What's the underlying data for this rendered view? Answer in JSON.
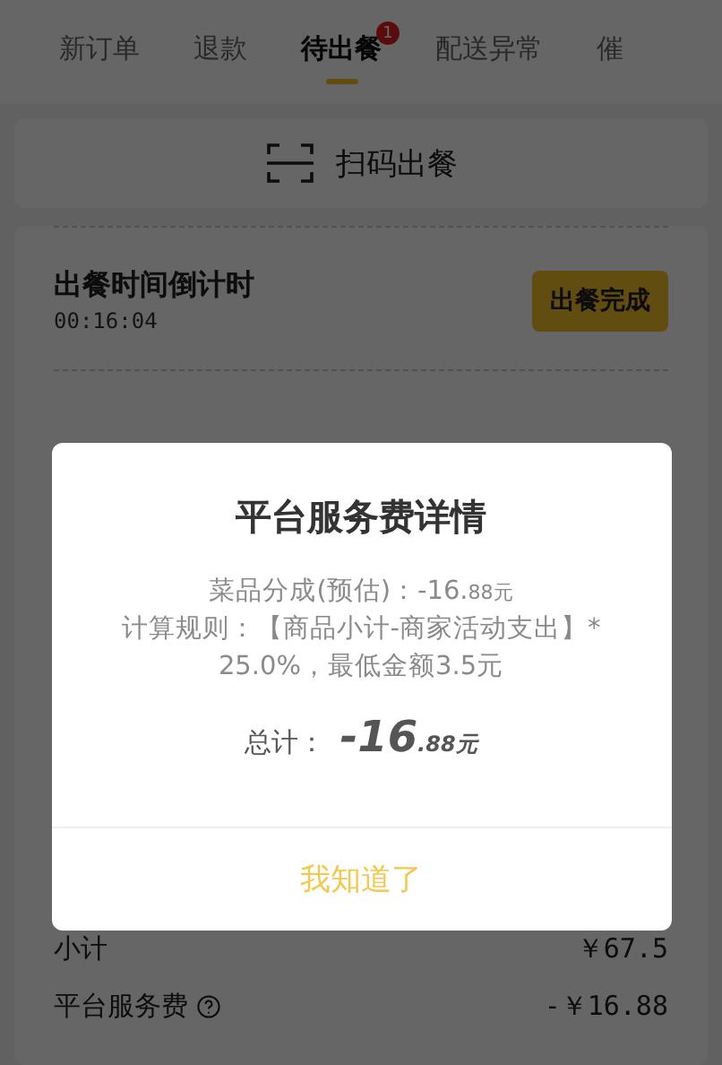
{
  "tabs": [
    {
      "label": "新订单",
      "selected": false
    },
    {
      "label": "退款",
      "selected": false
    },
    {
      "label": "待出餐",
      "selected": true,
      "badge": "1"
    },
    {
      "label": "配送异常",
      "selected": false
    },
    {
      "label": "催",
      "selected": false
    }
  ],
  "scan_button": {
    "label": "扫码出餐"
  },
  "order": {
    "countdown_title": "出餐时间倒计时",
    "countdown": "00:16:04",
    "done_button": "出餐完成",
    "fees": [
      {
        "label": "小计",
        "value": "￥67.5",
        "help": false
      },
      {
        "label": "平台服务费",
        "value": "-￥16.88",
        "help": true
      }
    ]
  },
  "dialog": {
    "title": "平台服务费详情",
    "share": {
      "label": "菜品分成(预估)：",
      "main": "-16.",
      "small": "88元"
    },
    "rule": "计算规则：【商品小计-商家活动支出】* 25.0%，最低金额3.5元",
    "total": {
      "label": "总计：",
      "main": "-16",
      "small": ".88元"
    },
    "confirm": "我知道了"
  }
}
